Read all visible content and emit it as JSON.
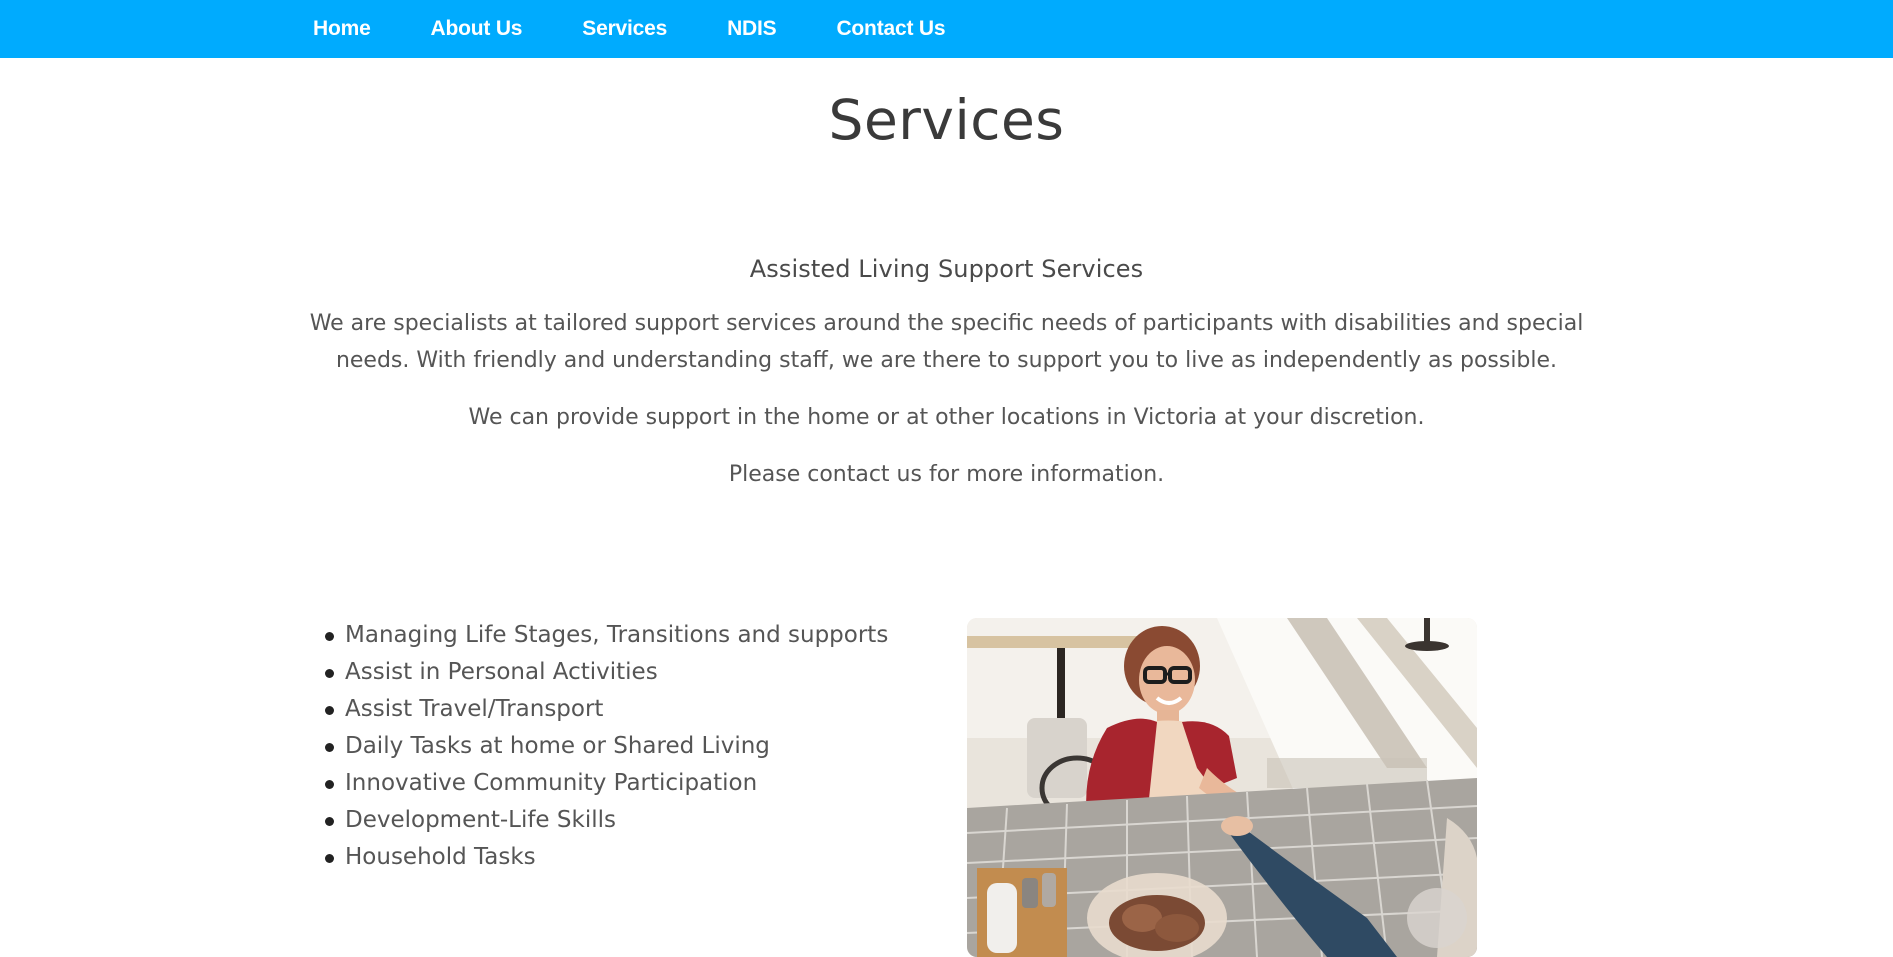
{
  "nav": {
    "items": [
      {
        "label": "Home"
      },
      {
        "label": "About Us"
      },
      {
        "label": "Services"
      },
      {
        "label": "NDIS"
      },
      {
        "label": "Contact Us"
      }
    ]
  },
  "page": {
    "title": "Services"
  },
  "intro": {
    "heading": "Assisted Living Support Services",
    "paragraphs": [
      "We are specialists at tailored support services around the specific needs of participants with disabilities and special needs. With friendly and understanding staff, we are there to support you to live as independently as possible.",
      "We can provide support in the home or at other locations in Victoria at your discretion.",
      "Please contact us for more information."
    ]
  },
  "services": {
    "items": [
      "Managing Life Stages, Transitions and supports",
      "Assist in Personal Activities",
      "Assist Travel/Transport",
      "Daily Tasks at home or Shared Living",
      "Innovative Community Participation",
      "Development-Life Skills",
      "Household Tasks"
    ]
  },
  "colors": {
    "nav_background": "#00abfe",
    "nav_text": "#ffffff",
    "title_text": "#3a3a3a",
    "body_text": "#555555"
  }
}
